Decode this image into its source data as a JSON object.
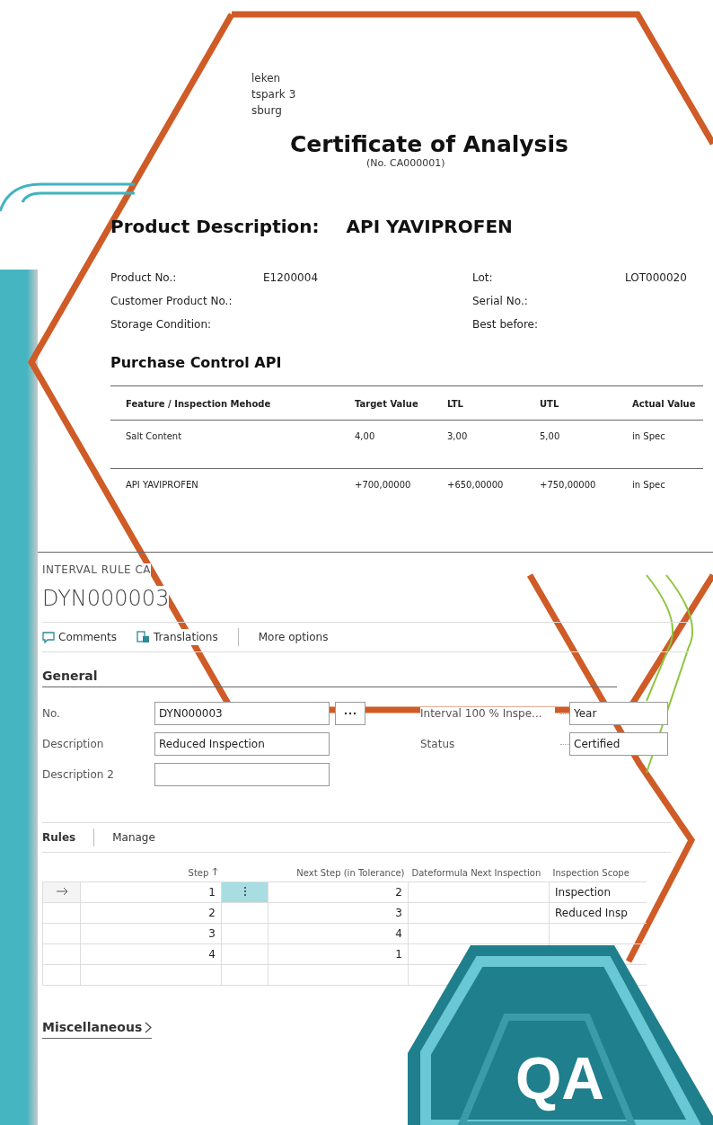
{
  "address_lines": [
    "leken",
    "tspark 3",
    "sburg"
  ],
  "certificate": {
    "title": "Certificate of Analysis",
    "number": "(No. CA000001)"
  },
  "product_description": {
    "label": "Product Description:",
    "value": "API YAVIPROFEN"
  },
  "product_fields": [
    {
      "label": "Product No.:",
      "value": "E1200004"
    },
    {
      "label": "Lot:",
      "value": "LOT000020"
    },
    {
      "label": "Customer Product No.:"
    },
    {
      "label": "Serial No.:"
    },
    {
      "label": "Storage Condition:"
    },
    {
      "label": "Best before:"
    }
  ],
  "section_title": "Purchase Control API",
  "results_table": {
    "columns": [
      "Feature / Inspection Mehode",
      "Target Value",
      "LTL",
      "UTL",
      "Actual Value"
    ],
    "rows": [
      [
        "Salt Content",
        "4,00",
        "3,00",
        "5,00",
        "in Spec"
      ],
      [
        "API YAVIPROFEN",
        "+700,00000",
        "+650,00000",
        "+750,00000",
        "in Spec"
      ]
    ]
  },
  "card": {
    "caption": "INTERVAL RULE CA",
    "title": "DYN000003",
    "actions": [
      {
        "label": "Comments",
        "kind": "comment"
      },
      {
        "label": "Translations",
        "kind": "translate"
      },
      {
        "label": "More options",
        "kind": "more"
      }
    ],
    "section": "General",
    "left_fields": [
      {
        "label": "No.",
        "value": "DYN000003",
        "kind": "lookup"
      },
      {
        "label": "Description",
        "value": "Reduced Inspection",
        "kind": "text"
      },
      {
        "label": "Description 2",
        "kind": "text"
      }
    ],
    "right_fields": [
      {
        "label": "Interval 100 % Inspe...",
        "value": "Year"
      },
      {
        "label": "Status",
        "value": "Certified"
      }
    ],
    "rules": {
      "tabs": [
        "Rules",
        "Manage"
      ],
      "columns": [
        "Step",
        "Next Step (in Tolerance)",
        "Dateformula Next Inspection",
        "Inspection Scope"
      ],
      "rows": [
        {
          "step": "1",
          "next": "2",
          "scope": "Inspection",
          "selected": true
        },
        {
          "step": "2",
          "next": "3",
          "scope": "Reduced Insp",
          "selected": false
        },
        {
          "step": "3",
          "next": "4",
          "selected": false
        },
        {
          "step": "4",
          "next": "1",
          "selected": false
        }
      ]
    },
    "collapsed_section": "Miscellaneous"
  },
  "badge": "QA"
}
